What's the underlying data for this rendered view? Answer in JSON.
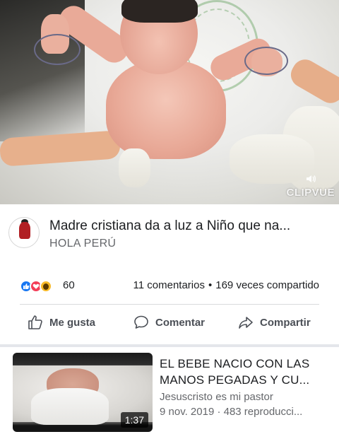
{
  "video": {
    "watermark": "CLIPVUE",
    "sound_icon": "speaker-sound-icon"
  },
  "post": {
    "title": "Madre cristiana da a luz a Niño que na...",
    "source": "HOLA PERÚ",
    "avatar_icon": "page-logo-icon"
  },
  "reactions": {
    "icons": [
      "like-reaction-icon",
      "love-reaction-icon",
      "wow-reaction-icon"
    ],
    "count": "60",
    "comments": "11 comentarios",
    "separator": "•",
    "shares": "169 veces compartido"
  },
  "actions": {
    "like_label": "Me gusta",
    "comment_label": "Comentar",
    "share_label": "Compartir"
  },
  "suggested": {
    "title_line1": "EL BEBE NACIO CON LAS",
    "title_line2": "MANOS PEGADAS Y CU...",
    "channel": "Jesuscristo es mi pastor",
    "meta": "9 nov. 2019 · 483 reproducci...",
    "duration": "1:37"
  },
  "colors": {
    "like": "#1877f2",
    "love": "#f33e58",
    "wow": "#f7b928",
    "text_secondary": "#65676b",
    "action_text": "#4b4f56"
  }
}
